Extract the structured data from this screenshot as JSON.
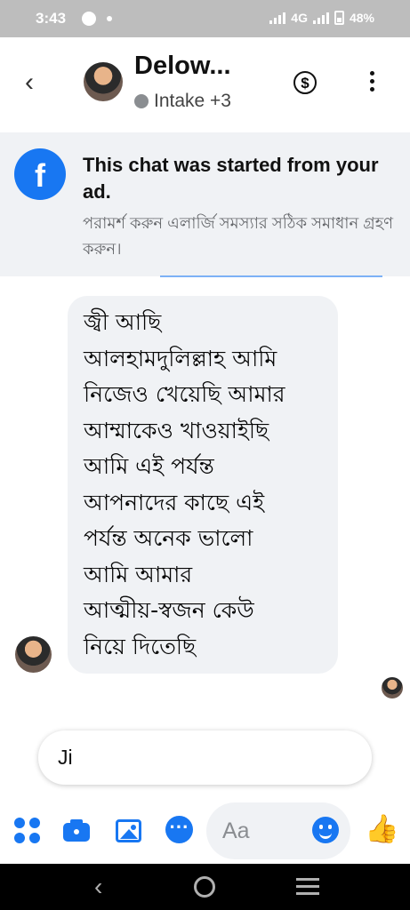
{
  "status_bar": {
    "time": "3:43",
    "network": "4G",
    "battery": "48%"
  },
  "header": {
    "title": "Delow...",
    "subtitle": "Intake +3",
    "back_glyph": "‹",
    "payment_glyph": "$"
  },
  "banner": {
    "title": "This chat was started from your ad.",
    "message": "পরামর্শ করুন এলার্জি সমস্যার সঠিক সমাধান গ্রহণ করুন।",
    "logo_glyph": "f"
  },
  "messages": [
    {
      "direction": "incoming",
      "lines": [
        "জ্বী আছি",
        "আলহামদুলিল্লাহ আমি",
        "নিজেও খেয়েছি আমার",
        "আম্মাকেও খাওয়াইছি",
        "আমি এই পর্যন্ত",
        "আপনাদের কাছে এই",
        "পর্যন্ত অনেক ভালো",
        "আমি আমার",
        "আত্মীয়-স্বজন কেউ",
        "নিয়ে দিতেছি"
      ]
    }
  ],
  "quick_reply": "Ji",
  "composer": {
    "placeholder": "Aa",
    "like_glyph": "👍"
  },
  "icons": {
    "status": [
      "messenger-icon",
      "signal-icon",
      "battery-icon"
    ],
    "composer": [
      "apps-icon",
      "camera-icon",
      "gallery-icon",
      "chat-bubble-icon",
      "emoji-icon",
      "thumbs-up-icon"
    ],
    "nav": [
      "nav-back-icon",
      "nav-home-icon",
      "nav-recents-icon"
    ]
  },
  "colors": {
    "accent": "#1877f2",
    "bubble": "#f0f2f5",
    "status_bar": "#bdbdbd",
    "nav_bar": "#000000"
  }
}
